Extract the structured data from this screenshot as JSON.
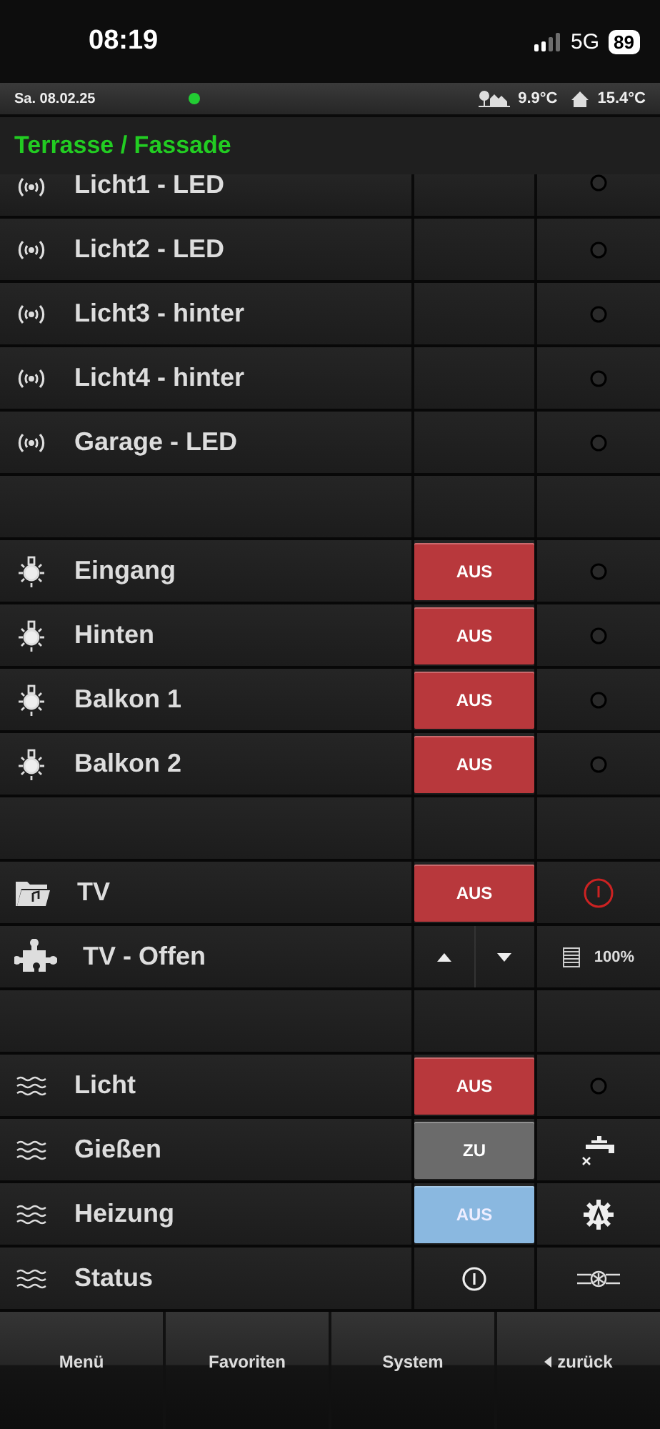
{
  "phone_status": {
    "time": "08:19",
    "network": "5G",
    "battery": "89"
  },
  "info_bar": {
    "date": "Sa. 08.02.25",
    "outdoor_temp": "9.9°C",
    "indoor_temp": "15.4°C"
  },
  "title": "Terrasse / Fassade",
  "rows": [
    {
      "kind": "radio",
      "label": "Licht1 - LED",
      "status": {
        "kind": "led"
      }
    },
    {
      "kind": "radio",
      "label": "Licht2 - LED",
      "status": {
        "kind": "led"
      }
    },
    {
      "kind": "radio",
      "label": "Licht3 - hinter",
      "status": {
        "kind": "led"
      }
    },
    {
      "kind": "radio",
      "label": "Licht4 - hinter",
      "status": {
        "kind": "led"
      }
    },
    {
      "kind": "radio",
      "label": "Garage - LED",
      "status": {
        "kind": "led"
      }
    },
    {
      "kind": "spacer"
    },
    {
      "kind": "lamp",
      "label": "Eingang",
      "control": {
        "kind": "button",
        "text": "AUS",
        "color": "#b8383c"
      },
      "status": {
        "kind": "led"
      }
    },
    {
      "kind": "lamp",
      "label": "Hinten",
      "control": {
        "kind": "button",
        "text": "AUS",
        "color": "#b8383c"
      },
      "status": {
        "kind": "led"
      }
    },
    {
      "kind": "lamp",
      "label": "Balkon 1",
      "control": {
        "kind": "button",
        "text": "AUS",
        "color": "#b8383c"
      },
      "status": {
        "kind": "led"
      }
    },
    {
      "kind": "lamp",
      "label": "Balkon 2",
      "control": {
        "kind": "button",
        "text": "AUS",
        "color": "#b8383c"
      },
      "status": {
        "kind": "led"
      }
    },
    {
      "kind": "spacer"
    },
    {
      "kind": "folder",
      "label": "TV",
      "control": {
        "kind": "button",
        "text": "AUS",
        "color": "#b8383c"
      },
      "status": {
        "kind": "power"
      }
    },
    {
      "kind": "puzzle",
      "label": "TV - Offen",
      "control": {
        "kind": "updown"
      },
      "status": {
        "kind": "blind",
        "text": "100%"
      }
    },
    {
      "kind": "spacer"
    },
    {
      "kind": "waves",
      "label": "Licht",
      "control": {
        "kind": "button",
        "text": "AUS",
        "color": "#b8383c"
      },
      "status": {
        "kind": "led"
      }
    },
    {
      "kind": "waves",
      "label": "Gießen",
      "control": {
        "kind": "button",
        "text": "ZU",
        "color": "#6b6b6b"
      },
      "status": {
        "kind": "tap"
      }
    },
    {
      "kind": "waves",
      "label": "Heizung",
      "control": {
        "kind": "button",
        "text": "AUS",
        "color": "#8ab8e0"
      },
      "status": {
        "kind": "gear"
      }
    },
    {
      "kind": "waves",
      "label": "Status",
      "control": {
        "kind": "info"
      },
      "status": {
        "kind": "valve"
      }
    }
  ],
  "nav": [
    {
      "label": "Menü",
      "kind": "plain"
    },
    {
      "label": "Favoriten",
      "kind": "plain"
    },
    {
      "label": "System",
      "kind": "plain"
    },
    {
      "label": "zurück",
      "kind": "back"
    }
  ]
}
